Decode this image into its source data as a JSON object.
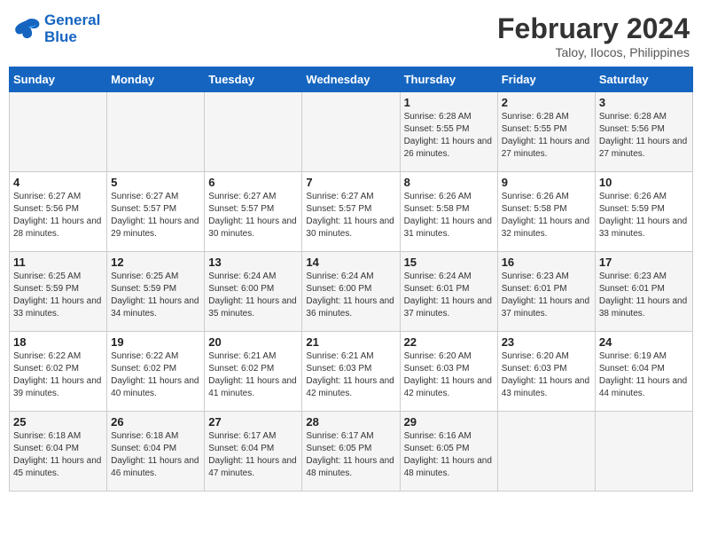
{
  "header": {
    "logo_line1": "General",
    "logo_line2": "Blue",
    "month_year": "February 2024",
    "location": "Taloy, Ilocos, Philippines"
  },
  "weekdays": [
    "Sunday",
    "Monday",
    "Tuesday",
    "Wednesday",
    "Thursday",
    "Friday",
    "Saturday"
  ],
  "weeks": [
    [
      {
        "day": "",
        "sunrise": "",
        "sunset": "",
        "daylight": ""
      },
      {
        "day": "",
        "sunrise": "",
        "sunset": "",
        "daylight": ""
      },
      {
        "day": "",
        "sunrise": "",
        "sunset": "",
        "daylight": ""
      },
      {
        "day": "",
        "sunrise": "",
        "sunset": "",
        "daylight": ""
      },
      {
        "day": "1",
        "sunrise": "Sunrise: 6:28 AM",
        "sunset": "Sunset: 5:55 PM",
        "daylight": "Daylight: 11 hours and 26 minutes."
      },
      {
        "day": "2",
        "sunrise": "Sunrise: 6:28 AM",
        "sunset": "Sunset: 5:55 PM",
        "daylight": "Daylight: 11 hours and 27 minutes."
      },
      {
        "day": "3",
        "sunrise": "Sunrise: 6:28 AM",
        "sunset": "Sunset: 5:56 PM",
        "daylight": "Daylight: 11 hours and 27 minutes."
      }
    ],
    [
      {
        "day": "4",
        "sunrise": "Sunrise: 6:27 AM",
        "sunset": "Sunset: 5:56 PM",
        "daylight": "Daylight: 11 hours and 28 minutes."
      },
      {
        "day": "5",
        "sunrise": "Sunrise: 6:27 AM",
        "sunset": "Sunset: 5:57 PM",
        "daylight": "Daylight: 11 hours and 29 minutes."
      },
      {
        "day": "6",
        "sunrise": "Sunrise: 6:27 AM",
        "sunset": "Sunset: 5:57 PM",
        "daylight": "Daylight: 11 hours and 30 minutes."
      },
      {
        "day": "7",
        "sunrise": "Sunrise: 6:27 AM",
        "sunset": "Sunset: 5:57 PM",
        "daylight": "Daylight: 11 hours and 30 minutes."
      },
      {
        "day": "8",
        "sunrise": "Sunrise: 6:26 AM",
        "sunset": "Sunset: 5:58 PM",
        "daylight": "Daylight: 11 hours and 31 minutes."
      },
      {
        "day": "9",
        "sunrise": "Sunrise: 6:26 AM",
        "sunset": "Sunset: 5:58 PM",
        "daylight": "Daylight: 11 hours and 32 minutes."
      },
      {
        "day": "10",
        "sunrise": "Sunrise: 6:26 AM",
        "sunset": "Sunset: 5:59 PM",
        "daylight": "Daylight: 11 hours and 33 minutes."
      }
    ],
    [
      {
        "day": "11",
        "sunrise": "Sunrise: 6:25 AM",
        "sunset": "Sunset: 5:59 PM",
        "daylight": "Daylight: 11 hours and 33 minutes."
      },
      {
        "day": "12",
        "sunrise": "Sunrise: 6:25 AM",
        "sunset": "Sunset: 5:59 PM",
        "daylight": "Daylight: 11 hours and 34 minutes."
      },
      {
        "day": "13",
        "sunrise": "Sunrise: 6:24 AM",
        "sunset": "Sunset: 6:00 PM",
        "daylight": "Daylight: 11 hours and 35 minutes."
      },
      {
        "day": "14",
        "sunrise": "Sunrise: 6:24 AM",
        "sunset": "Sunset: 6:00 PM",
        "daylight": "Daylight: 11 hours and 36 minutes."
      },
      {
        "day": "15",
        "sunrise": "Sunrise: 6:24 AM",
        "sunset": "Sunset: 6:01 PM",
        "daylight": "Daylight: 11 hours and 37 minutes."
      },
      {
        "day": "16",
        "sunrise": "Sunrise: 6:23 AM",
        "sunset": "Sunset: 6:01 PM",
        "daylight": "Daylight: 11 hours and 37 minutes."
      },
      {
        "day": "17",
        "sunrise": "Sunrise: 6:23 AM",
        "sunset": "Sunset: 6:01 PM",
        "daylight": "Daylight: 11 hours and 38 minutes."
      }
    ],
    [
      {
        "day": "18",
        "sunrise": "Sunrise: 6:22 AM",
        "sunset": "Sunset: 6:02 PM",
        "daylight": "Daylight: 11 hours and 39 minutes."
      },
      {
        "day": "19",
        "sunrise": "Sunrise: 6:22 AM",
        "sunset": "Sunset: 6:02 PM",
        "daylight": "Daylight: 11 hours and 40 minutes."
      },
      {
        "day": "20",
        "sunrise": "Sunrise: 6:21 AM",
        "sunset": "Sunset: 6:02 PM",
        "daylight": "Daylight: 11 hours and 41 minutes."
      },
      {
        "day": "21",
        "sunrise": "Sunrise: 6:21 AM",
        "sunset": "Sunset: 6:03 PM",
        "daylight": "Daylight: 11 hours and 42 minutes."
      },
      {
        "day": "22",
        "sunrise": "Sunrise: 6:20 AM",
        "sunset": "Sunset: 6:03 PM",
        "daylight": "Daylight: 11 hours and 42 minutes."
      },
      {
        "day": "23",
        "sunrise": "Sunrise: 6:20 AM",
        "sunset": "Sunset: 6:03 PM",
        "daylight": "Daylight: 11 hours and 43 minutes."
      },
      {
        "day": "24",
        "sunrise": "Sunrise: 6:19 AM",
        "sunset": "Sunset: 6:04 PM",
        "daylight": "Daylight: 11 hours and 44 minutes."
      }
    ],
    [
      {
        "day": "25",
        "sunrise": "Sunrise: 6:18 AM",
        "sunset": "Sunset: 6:04 PM",
        "daylight": "Daylight: 11 hours and 45 minutes."
      },
      {
        "day": "26",
        "sunrise": "Sunrise: 6:18 AM",
        "sunset": "Sunset: 6:04 PM",
        "daylight": "Daylight: 11 hours and 46 minutes."
      },
      {
        "day": "27",
        "sunrise": "Sunrise: 6:17 AM",
        "sunset": "Sunset: 6:04 PM",
        "daylight": "Daylight: 11 hours and 47 minutes."
      },
      {
        "day": "28",
        "sunrise": "Sunrise: 6:17 AM",
        "sunset": "Sunset: 6:05 PM",
        "daylight": "Daylight: 11 hours and 48 minutes."
      },
      {
        "day": "29",
        "sunrise": "Sunrise: 6:16 AM",
        "sunset": "Sunset: 6:05 PM",
        "daylight": "Daylight: 11 hours and 48 minutes."
      },
      {
        "day": "",
        "sunrise": "",
        "sunset": "",
        "daylight": ""
      },
      {
        "day": "",
        "sunrise": "",
        "sunset": "",
        "daylight": ""
      }
    ]
  ]
}
